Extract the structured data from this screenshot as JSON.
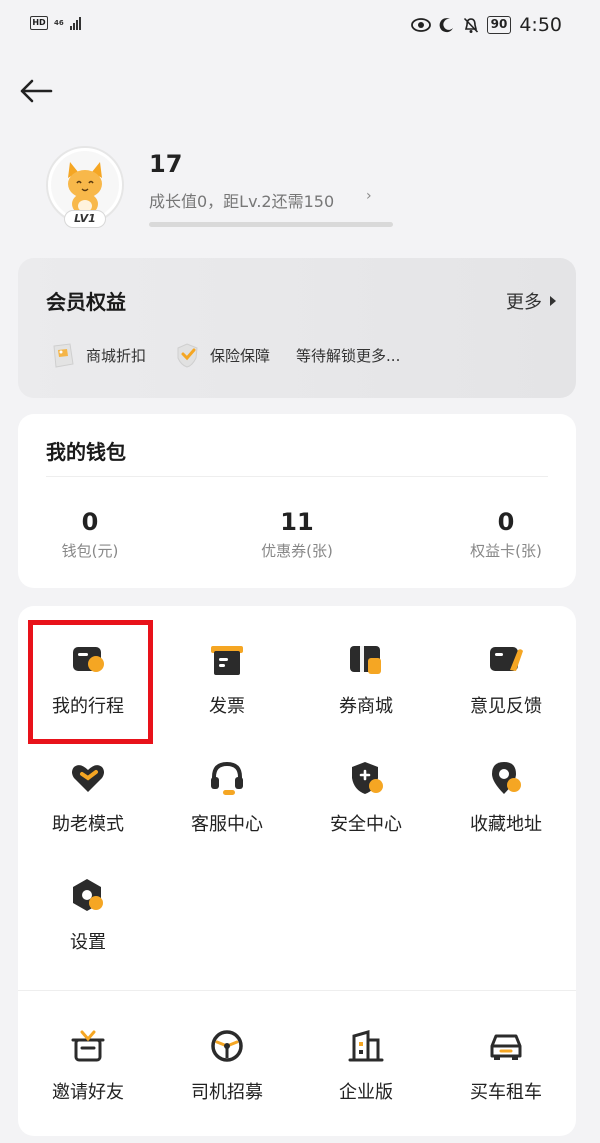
{
  "status_bar": {
    "network": "46",
    "battery": "90",
    "time": "4:50"
  },
  "profile": {
    "username": "17",
    "level_badge": "LV1",
    "growth_text": "成长值0，距Lv.2还需150",
    "growth_progress": 0
  },
  "membership": {
    "title": "会员权益",
    "more_label": "更多",
    "benefits": [
      {
        "label": "商城折扣",
        "icon": "store-discount-icon"
      },
      {
        "label": "保险保障",
        "icon": "insurance-shield-icon"
      },
      {
        "label": "等待解锁更多..."
      }
    ]
  },
  "wallet": {
    "title": "我的钱包",
    "stats": [
      {
        "value": "0",
        "label": "钱包(元)"
      },
      {
        "value": "11",
        "label": "优惠券(张)"
      },
      {
        "value": "0",
        "label": "权益卡(张)"
      }
    ]
  },
  "services": [
    {
      "label": "我的行程",
      "icon": "trip-icon"
    },
    {
      "label": "发票",
      "icon": "invoice-icon"
    },
    {
      "label": "券商城",
      "icon": "coupon-mall-icon"
    },
    {
      "label": "意见反馈",
      "icon": "feedback-icon"
    },
    {
      "label": "助老模式",
      "icon": "elderly-mode-icon"
    },
    {
      "label": "客服中心",
      "icon": "headset-icon"
    },
    {
      "label": "安全中心",
      "icon": "shield-plus-icon"
    },
    {
      "label": "收藏地址",
      "icon": "location-pin-icon"
    },
    {
      "label": "设置",
      "icon": "gear-icon"
    }
  ],
  "extras": [
    {
      "label": "邀请好友",
      "icon": "gift-icon"
    },
    {
      "label": "司机招募",
      "icon": "steering-wheel-icon"
    },
    {
      "label": "企业版",
      "icon": "building-icon"
    },
    {
      "label": "买车租车",
      "icon": "car-icon"
    }
  ],
  "colors": {
    "accent": "#f5a623",
    "icon_dark": "#2b2b2b",
    "highlight": "#e8121a"
  }
}
